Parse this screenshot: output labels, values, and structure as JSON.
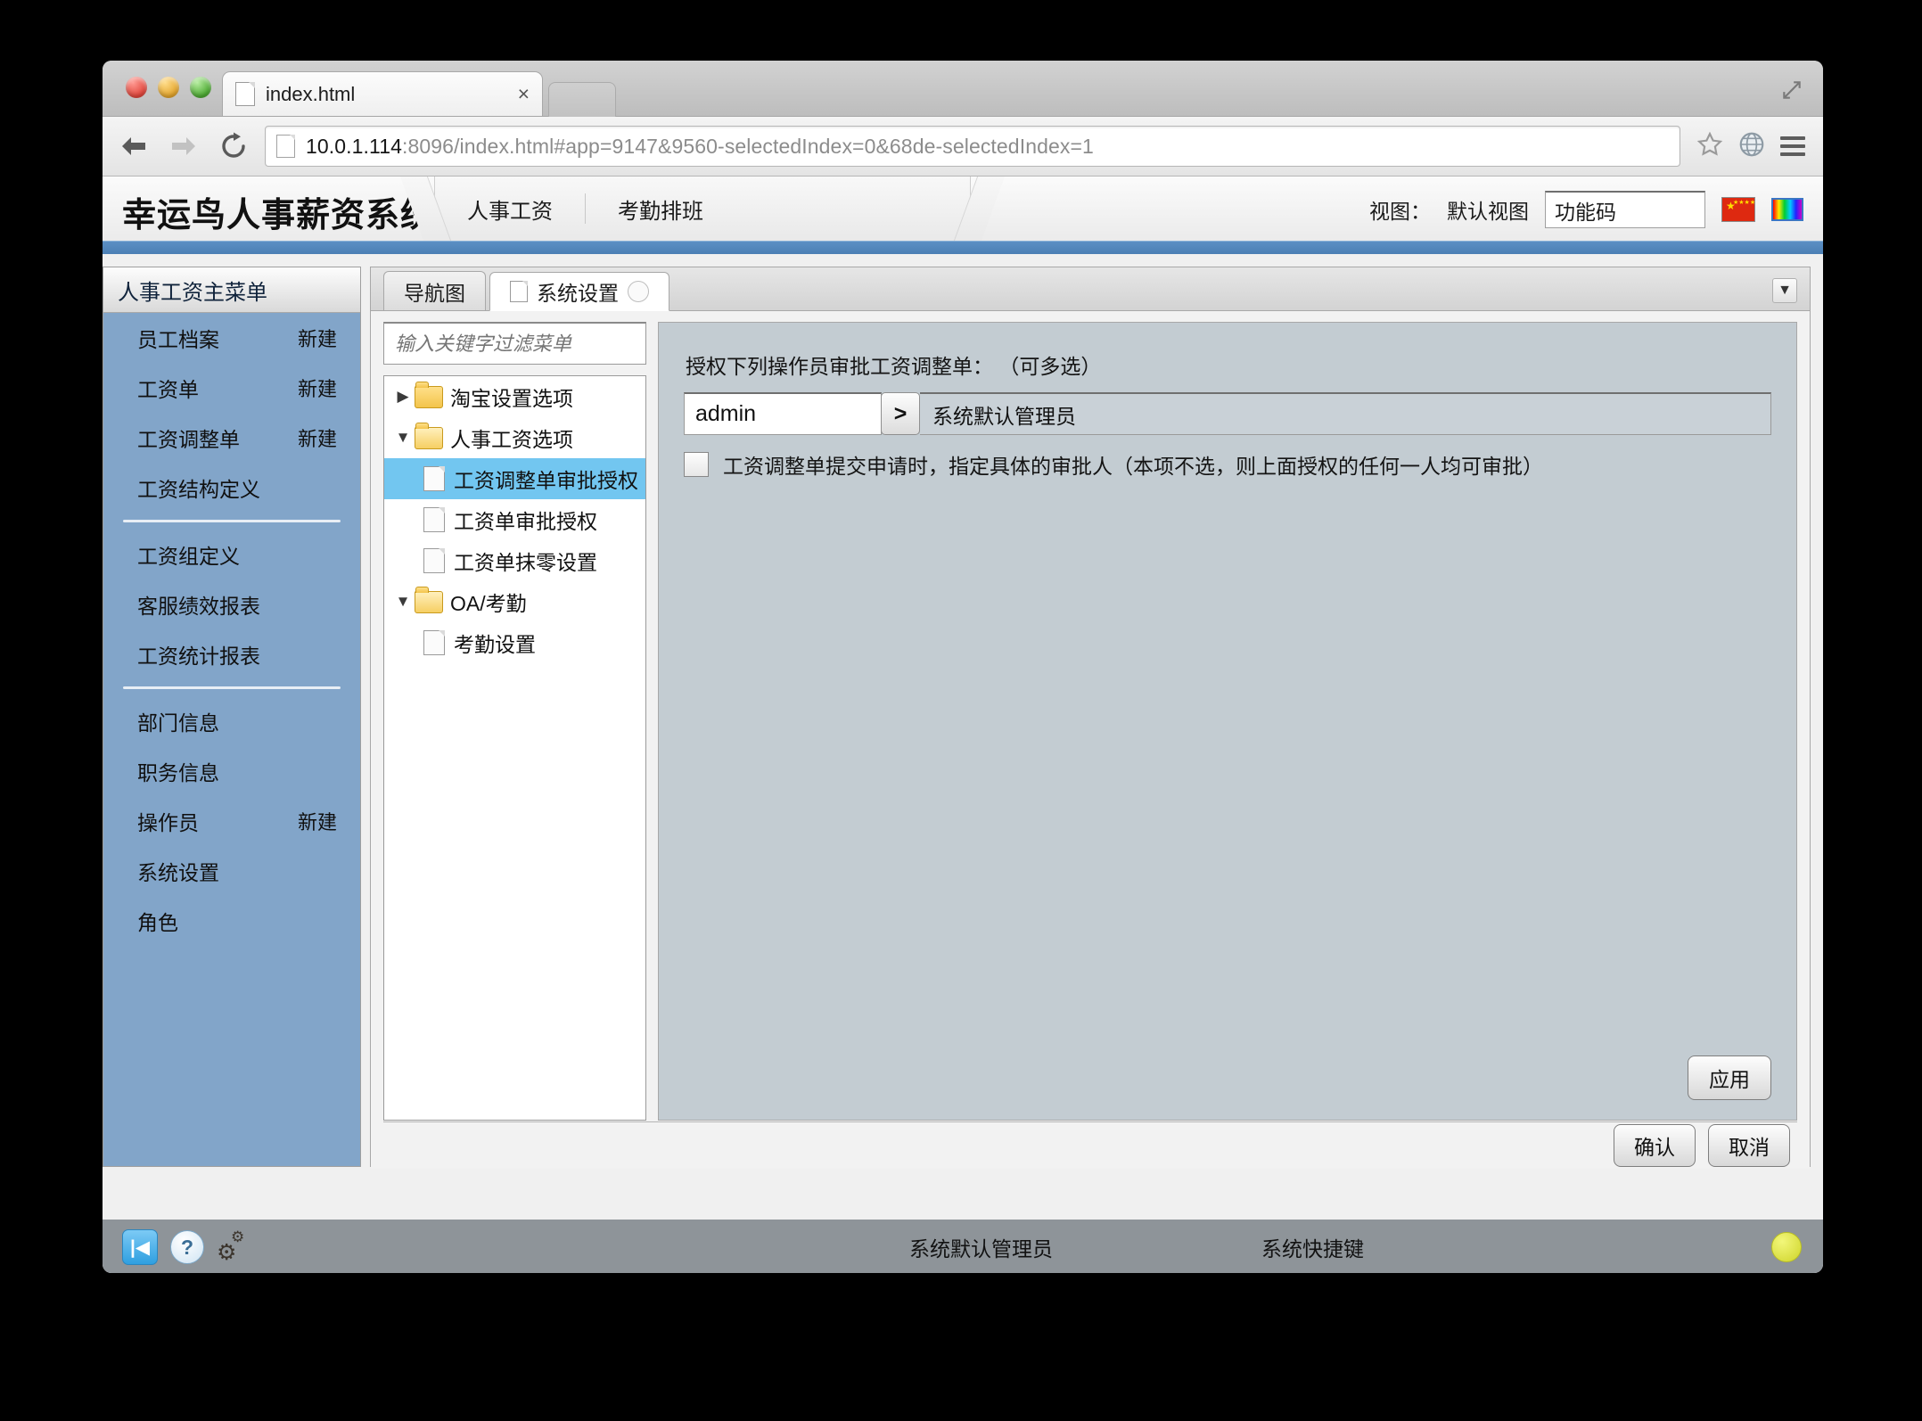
{
  "browser": {
    "tab_title": "index.html",
    "tab_close": "×",
    "url_host": "10.0.1.114",
    "url_rest": ":8096/index.html#app=9147&9560-selectedIndex=0&68de-selectedIndex=1"
  },
  "header": {
    "brand": "幸运鸟人事薪资系统",
    "module_tabs": [
      "人事工资",
      "考勤排班"
    ],
    "view_label": "视图：",
    "view_value": "默认视图",
    "function_code_value": "功能码",
    "flag_icon": "cn-flag-icon",
    "color_icon": "color-palette-icon"
  },
  "sidebar": {
    "title": "人事工资主菜单",
    "groups": [
      [
        {
          "label": "员工档案",
          "action": "新建"
        },
        {
          "label": "工资单",
          "action": "新建"
        },
        {
          "label": "工资调整单",
          "action": "新建"
        },
        {
          "label": "工资结构定义",
          "action": ""
        }
      ],
      [
        {
          "label": "工资组定义",
          "action": ""
        },
        {
          "label": "客服绩效报表",
          "action": ""
        },
        {
          "label": "工资统计报表",
          "action": ""
        }
      ],
      [
        {
          "label": "部门信息",
          "action": ""
        },
        {
          "label": "职务信息",
          "action": ""
        },
        {
          "label": "操作员",
          "action": "新建"
        },
        {
          "label": "系统设置",
          "action": ""
        },
        {
          "label": "角色",
          "action": ""
        }
      ]
    ]
  },
  "work": {
    "tabs": [
      {
        "label": "导航图",
        "active": false,
        "has_doc_icon": false,
        "has_close": false
      },
      {
        "label": "系统设置",
        "active": true,
        "has_doc_icon": true,
        "has_close": true
      }
    ],
    "overflow_icon": "chevron-down-icon",
    "filter_placeholder": "输入关键字过滤菜单",
    "tree": [
      {
        "label": "淘宝设置选项",
        "type": "folder",
        "expanded": false,
        "twisty": "▶",
        "selected": false
      },
      {
        "label": "人事工资选项",
        "type": "folder",
        "expanded": true,
        "twisty": "▼",
        "selected": false
      },
      {
        "label": "工资调整单审批授权",
        "type": "leaf",
        "selected": true
      },
      {
        "label": "工资单审批授权",
        "type": "leaf",
        "selected": false
      },
      {
        "label": "工资单抹零设置",
        "type": "leaf",
        "selected": false
      },
      {
        "label": "OA/考勤",
        "type": "folder",
        "expanded": true,
        "twisty": "▼",
        "selected": false
      },
      {
        "label": "考勤设置",
        "type": "leaf",
        "selected": false
      }
    ]
  },
  "form": {
    "title": "授权下列操作员审批工资调整单： （可多选）",
    "operator_value": "admin",
    "go_button": ">",
    "operator_name": "系统默认管理员",
    "checkbox_checked": false,
    "checkbox_label": "工资调整单提交申请时，指定具体的审批人（本项不选，则上面授权的任何一人均可审批）",
    "apply_label": "应用"
  },
  "actions": {
    "confirm_label": "确认",
    "cancel_label": "取消"
  },
  "statusbar": {
    "collapse_icon": "collapse-left-icon",
    "help_icon": "help-icon",
    "settings_icon": "gears-icon",
    "user": "系统默认管理员",
    "shortcut": "系统快捷键",
    "status_dot": "status-indicator"
  },
  "colors": {
    "accent_blue": "#4b7fb4",
    "sidebar_blue": "#82a5c9",
    "tree_select": "#72c6f0",
    "panel_grey": "#c3ccd2"
  }
}
